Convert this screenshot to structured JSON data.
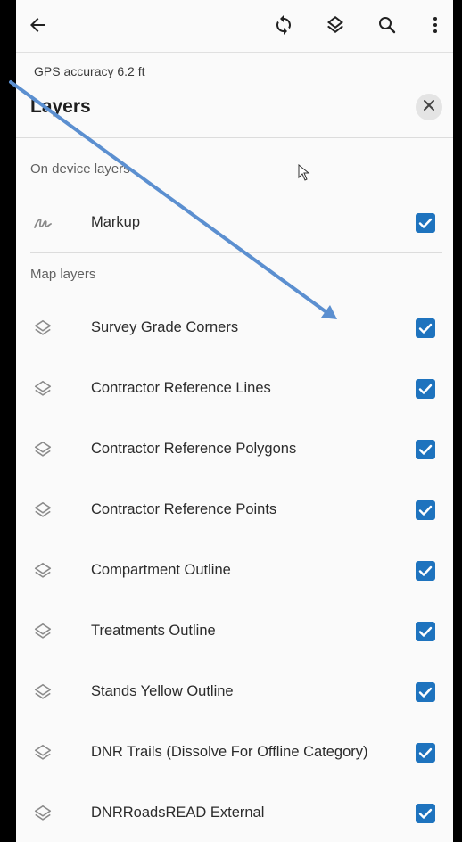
{
  "app_bar": {
    "back_icon": "arrow-back-icon",
    "sync_icon": "sync-icon",
    "layers_icon": "layers-icon",
    "search_icon": "search-icon",
    "more_icon": "more-vertical-icon"
  },
  "status": {
    "gps_accuracy": "GPS accuracy 6.2 ft"
  },
  "panel": {
    "title": "Layers",
    "close_icon": "close-icon"
  },
  "sections": {
    "on_device_label": "On device layers",
    "map_layers_label": "Map layers"
  },
  "on_device_layers": [
    {
      "label": "Markup",
      "icon": "markup-squiggle-icon",
      "checked": true
    }
  ],
  "map_layers": [
    {
      "label": "Survey Grade Corners",
      "icon": "layer-stack-icon",
      "checked": true
    },
    {
      "label": "Contractor Reference Lines",
      "icon": "layer-stack-icon",
      "checked": true
    },
    {
      "label": "Contractor Reference Polygons",
      "icon": "layer-stack-icon",
      "checked": true
    },
    {
      "label": "Contractor Reference Points",
      "icon": "layer-stack-icon",
      "checked": true
    },
    {
      "label": "Compartment Outline",
      "icon": "layer-stack-icon",
      "checked": true
    },
    {
      "label": "Treatments Outline",
      "icon": "layer-stack-icon",
      "checked": true
    },
    {
      "label": "Stands Yellow Outline",
      "icon": "layer-stack-icon",
      "checked": true
    },
    {
      "label": "DNR Trails (Dissolve For Offline Category)",
      "icon": "layer-stack-icon",
      "checked": true
    },
    {
      "label": "DNRRoadsREAD External",
      "icon": "layer-stack-icon",
      "checked": true
    }
  ],
  "colors": {
    "checkbox": "#1e73be",
    "annotation_arrow": "#5b8fd0",
    "frame": "#000000"
  }
}
